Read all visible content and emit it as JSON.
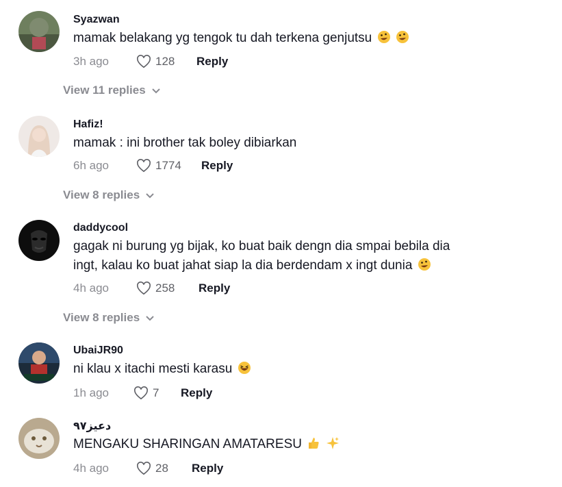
{
  "comments": [
    {
      "username": "Syazwan",
      "text": "mamak belakang yg tengok tu dah terkena genjutsu",
      "emoji": [
        "rolling-on-floor-laughing-emoji",
        "rolling-on-floor-laughing-emoji"
      ],
      "time": "3h ago",
      "likes": "128",
      "reply_label": "Reply",
      "view_replies": "View 11 replies"
    },
    {
      "username": "Hafiz!",
      "text": "mamak : ini brother tak boley dibiarkan",
      "time": "6h ago",
      "likes": "1774",
      "reply_label": "Reply",
      "view_replies": "View 8 replies"
    },
    {
      "username": "daddycool",
      "text_line1": "gagak ni burung yg bijak, ko buat baik dengn dia smpai bebila dia",
      "text_line2": "ingt, kalau ko buat jahat siap la dia berdendam x ingt dunia",
      "emoji": [
        "rolling-on-floor-laughing-emoji"
      ],
      "time": "4h ago",
      "likes": "258",
      "reply_label": "Reply",
      "view_replies": "View 8 replies"
    },
    {
      "username": "UbaiJR90",
      "text": "ni klau x itachi mesti karasu",
      "emoji": [
        "laughing-emoji"
      ],
      "time": "1h ago",
      "likes": "7",
      "reply_label": "Reply"
    },
    {
      "username": "دعيز٩٧",
      "text": "MENGAKU SHARINGAN AMATARESU",
      "emoji": [
        "thumbs-up-emoji",
        "sparkles-emoji"
      ],
      "time": "4h ago",
      "likes": "28",
      "reply_label": "Reply"
    }
  ],
  "colors": {
    "text": "#161823",
    "muted": "#8a8b91",
    "background": "#ffffff"
  }
}
